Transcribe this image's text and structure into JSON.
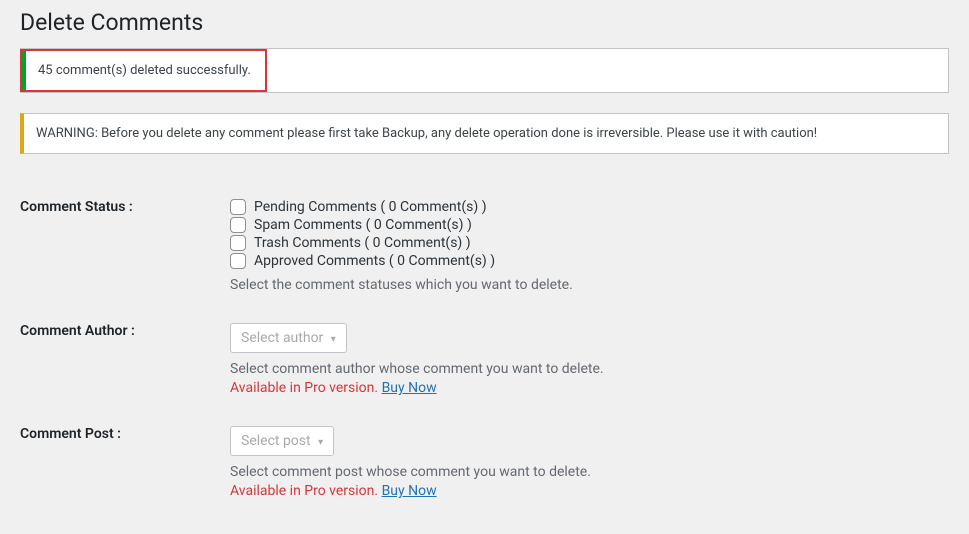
{
  "page_title": "Delete Comments",
  "success_notice": "45 comment(s) deleted successfully.",
  "warning_notice": "WARNING: Before you delete any comment please first take Backup, any delete operation done is irreversible. Please use it with caution!",
  "sections": {
    "status": {
      "label": "Comment Status :",
      "options": {
        "pending": "Pending Comments ( 0 Comment(s) )",
        "spam": "Spam Comments ( 0 Comment(s) )",
        "trash": "Trash Comments ( 0 Comment(s) )",
        "approved": "Approved Comments ( 0 Comment(s) )"
      },
      "description": "Select the comment statuses which you want to delete."
    },
    "author": {
      "label": "Comment Author :",
      "placeholder": "Select author",
      "description": "Select comment author whose comment you want to delete.",
      "pro_text": "Available in Pro version.",
      "buy_link": "Buy Now"
    },
    "post": {
      "label": "Comment Post :",
      "placeholder": "Select post",
      "description": "Select comment post whose comment you want to delete.",
      "pro_text": "Available in Pro version.",
      "buy_link": "Buy Now"
    }
  }
}
